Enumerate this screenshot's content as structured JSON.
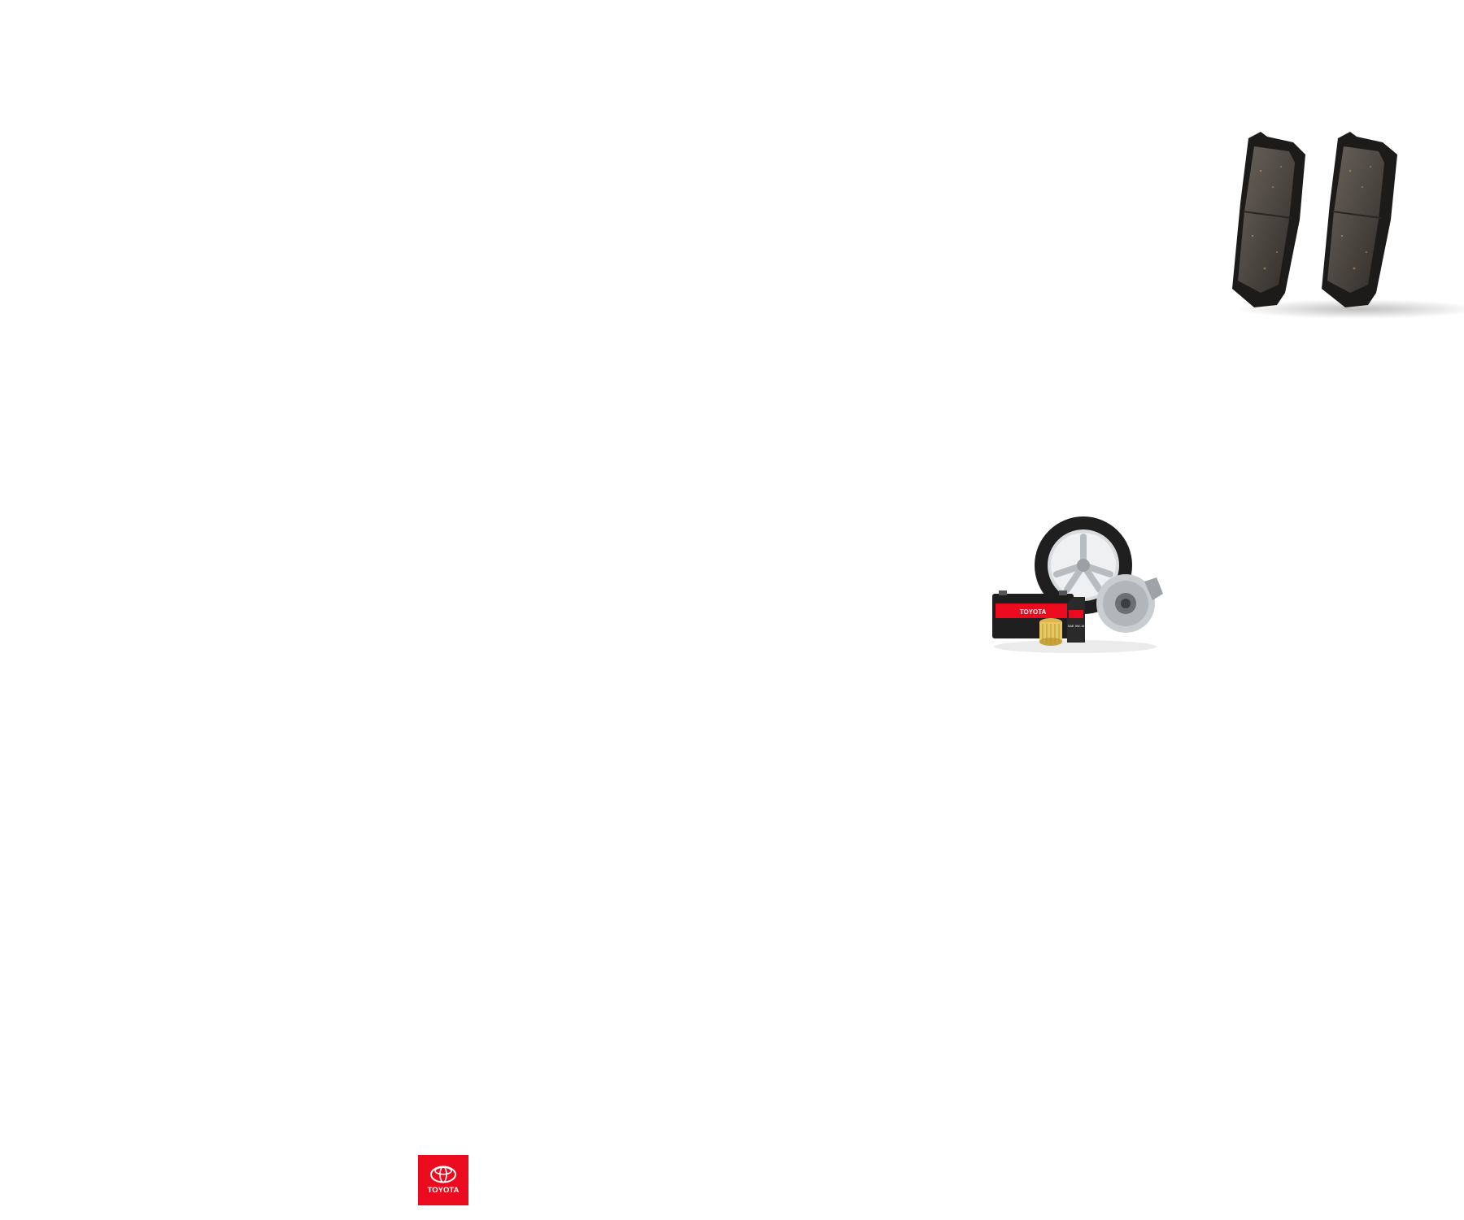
{
  "brake_pads_image": {
    "alt": "Brake pads"
  },
  "parts_bundle_image": {
    "alt": "Genuine parts bundle",
    "battery_label": "TOYOTA",
    "oil_label": "SAE 0W-16"
  },
  "footer": {
    "logo_text": "TOYOTA",
    "brand_color": "#eb0a1e"
  }
}
